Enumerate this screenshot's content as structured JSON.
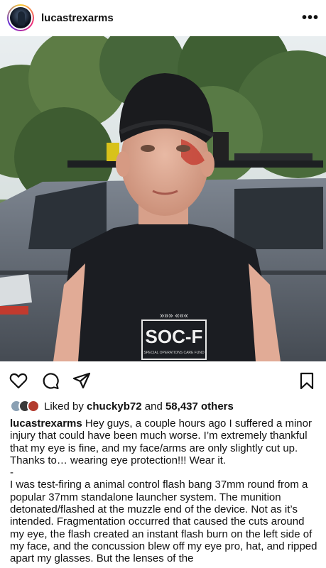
{
  "header": {
    "username": "lucastrexarms",
    "more_icon": "more-dots-icon",
    "more_label": "•••"
  },
  "photo": {
    "shirt_text": "SOC-F",
    "shirt_small_text": "SPECIAL OPERATIONS CARE FUND",
    "chevrons": "»»» «««"
  },
  "actions": {
    "icons": [
      "heart-icon",
      "comment-icon",
      "share-icon",
      "bookmark-icon"
    ]
  },
  "likes": {
    "prefix": "Liked by",
    "user": "chuckyb72",
    "middle": "and",
    "count": "58,437 others"
  },
  "caption": {
    "username": "lucastrexarms",
    "text1": "Hey guys, a couple hours ago I suffered a minor injury that could have been much worse. I’m extremely thankful that my eye is fine, and my face/arms are only slightly cut up. Thanks to… wearing eye protection!!! Wear it.",
    "dash": "-",
    "text2": "I was test-firing a animal control flash bang 37mm round from a popular 37mm standalone launcher system. The munition detonated/flashed at the muzzle end of the device. Not as it’s intended. Fragmentation occurred that caused the cuts around my eye, the flash created an instant flash burn on the left side of my face, and the concussion blew off my eye pro, hat, and ripped apart my glasses. But the lenses of the"
  },
  "colors": {
    "text": "#111111",
    "story_ring": [
      "#f9ce34",
      "#ee2a7b",
      "#6228d7"
    ],
    "shirt": "#1b1d22",
    "vehicle": "#5e6670",
    "foliage": "#4f6e3c"
  }
}
